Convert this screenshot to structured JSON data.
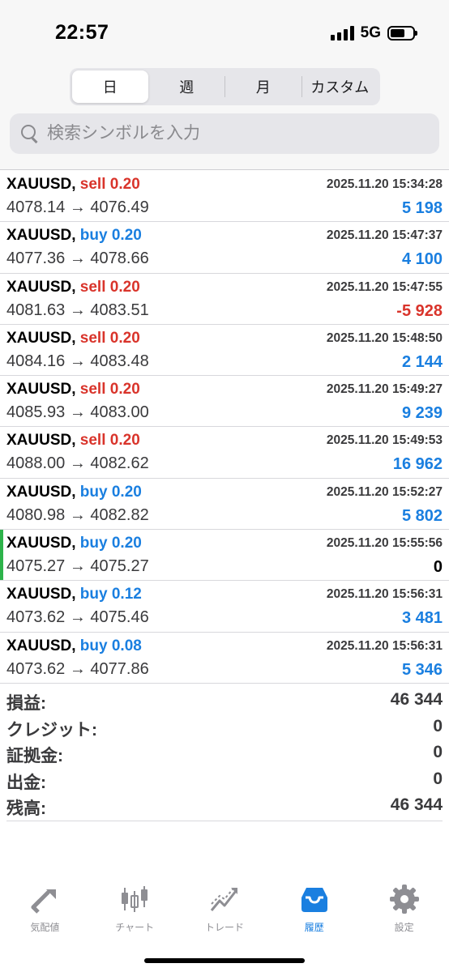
{
  "status_bar": {
    "time": "22:57",
    "network": "5G"
  },
  "period_tabs": [
    {
      "label": "日",
      "active": true
    },
    {
      "label": "週",
      "active": false
    },
    {
      "label": "月",
      "active": false
    },
    {
      "label": "カスタム",
      "active": false
    }
  ],
  "search": {
    "placeholder": "検索シンボルを入力"
  },
  "trades": [
    {
      "symbol": "XAUUSD,",
      "side": "sell",
      "lot": "0.20",
      "open": "4078.14",
      "close": "4076.49",
      "time": "2025.11.20 15:34:28",
      "profit": "5 198"
    },
    {
      "symbol": "XAUUSD,",
      "side": "buy",
      "lot": "0.20",
      "open": "4077.36",
      "close": "4078.66",
      "time": "2025.11.20 15:47:37",
      "profit": "4 100"
    },
    {
      "symbol": "XAUUSD,",
      "side": "sell",
      "lot": "0.20",
      "open": "4081.63",
      "close": "4083.51",
      "time": "2025.11.20 15:47:55",
      "profit": "-5 928"
    },
    {
      "symbol": "XAUUSD,",
      "side": "sell",
      "lot": "0.20",
      "open": "4084.16",
      "close": "4083.48",
      "time": "2025.11.20 15:48:50",
      "profit": "2 144"
    },
    {
      "symbol": "XAUUSD,",
      "side": "sell",
      "lot": "0.20",
      "open": "4085.93",
      "close": "4083.00",
      "time": "2025.11.20 15:49:27",
      "profit": "9 239"
    },
    {
      "symbol": "XAUUSD,",
      "side": "sell",
      "lot": "0.20",
      "open": "4088.00",
      "close": "4082.62",
      "time": "2025.11.20 15:49:53",
      "profit": "16 962"
    },
    {
      "symbol": "XAUUSD,",
      "side": "buy",
      "lot": "0.20",
      "open": "4080.98",
      "close": "4082.82",
      "time": "2025.11.20 15:52:27",
      "profit": "5 802"
    },
    {
      "symbol": "XAUUSD,",
      "side": "buy",
      "lot": "0.20",
      "open": "4075.27",
      "close": "4075.27",
      "time": "2025.11.20 15:55:56",
      "profit": "0",
      "highlight": true
    },
    {
      "symbol": "XAUUSD,",
      "side": "buy",
      "lot": "0.12",
      "open": "4073.62",
      "close": "4075.46",
      "time": "2025.11.20 15:56:31",
      "profit": "3 481"
    },
    {
      "symbol": "XAUUSD,",
      "side": "buy",
      "lot": "0.08",
      "open": "4073.62",
      "close": "4077.86",
      "time": "2025.11.20 15:56:31",
      "profit": "5 346"
    }
  ],
  "arrow": "→",
  "summary": [
    {
      "label": "損益:",
      "value": "46 344"
    },
    {
      "label": "クレジット:",
      "value": "0"
    },
    {
      "label": "証拠金:",
      "value": "0"
    },
    {
      "label": "出金:",
      "value": "0"
    },
    {
      "label": "残高:",
      "value": "46 344"
    }
  ],
  "tabbar": [
    {
      "label": "気配値",
      "icon": "quotes-icon",
      "active": false
    },
    {
      "label": "チャート",
      "icon": "chart-icon",
      "active": false
    },
    {
      "label": "トレード",
      "icon": "trade-icon",
      "active": false
    },
    {
      "label": "履歴",
      "icon": "history-icon",
      "active": true
    },
    {
      "label": "設定",
      "icon": "settings-icon",
      "active": false
    }
  ],
  "colors": {
    "sell": "#d9342b",
    "buy": "#1a7fe0",
    "active_tab": "#1a7fe0",
    "inactive_icon": "#8e8e93",
    "highlight_bar": "#2db34a"
  }
}
